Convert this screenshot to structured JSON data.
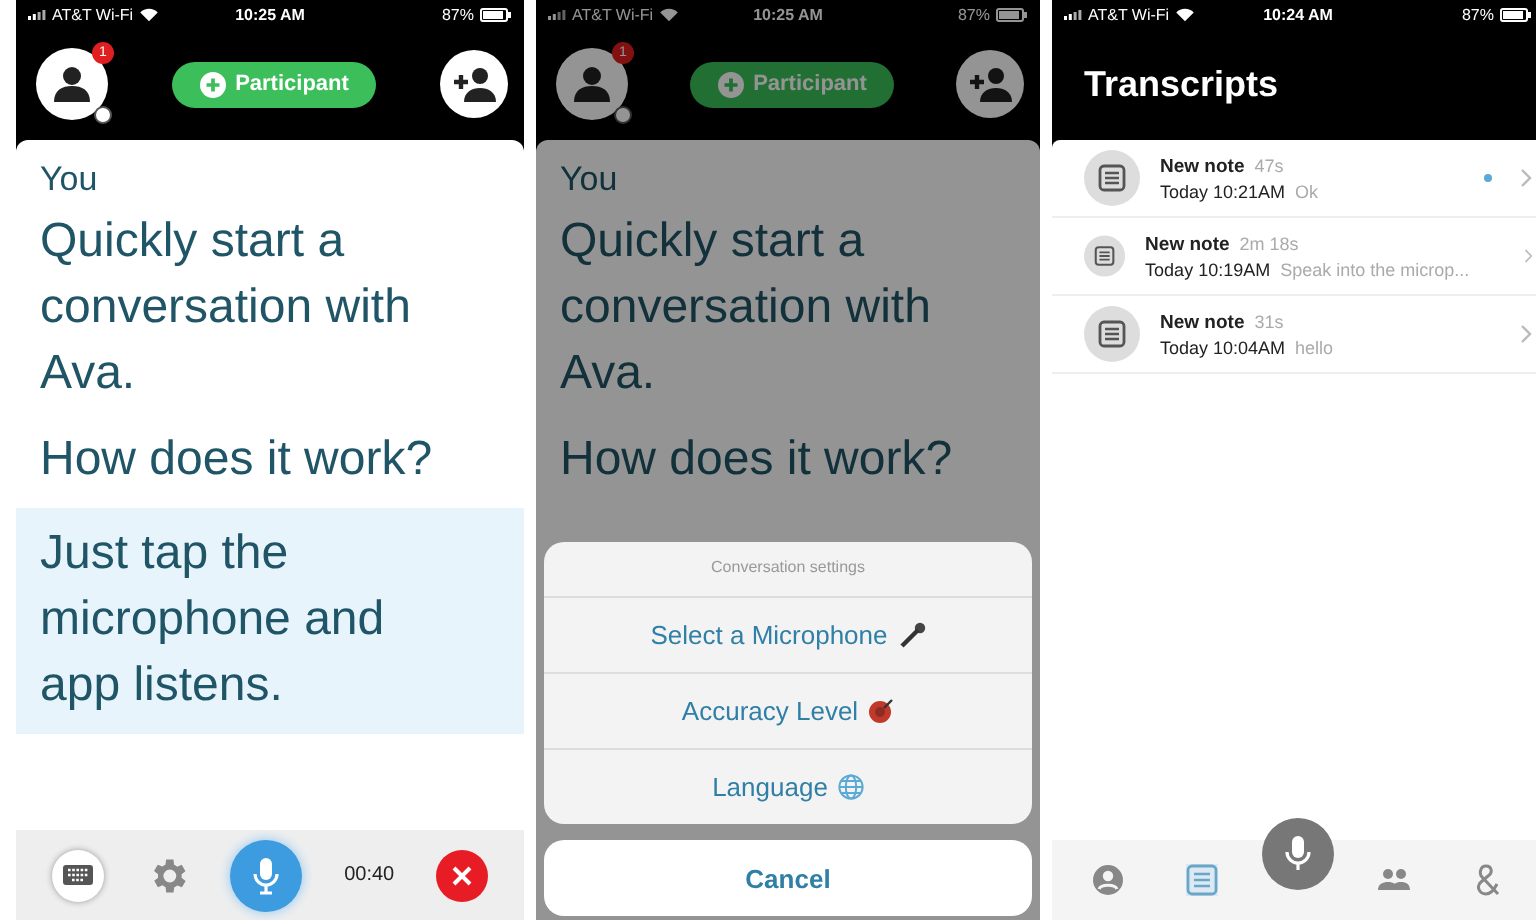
{
  "screens": [
    {
      "kind": "conversation",
      "dimmed": false,
      "status_bar": {
        "carrier": "AT&T Wi-Fi",
        "time": "10:25 AM",
        "battery": "87%"
      },
      "header": {
        "badge": "1",
        "participant_button": "Participant"
      },
      "messages": [
        {
          "kind": "speaker",
          "text": "You",
          "highlighted": false
        },
        {
          "kind": "message",
          "text": "Quickly start a conversation with Ava.",
          "highlighted": false
        },
        {
          "kind": "message",
          "text": "How does it work?",
          "highlighted": false
        },
        {
          "kind": "message",
          "text": "Just tap the microphone and app listens.",
          "highlighted": true
        }
      ],
      "toolbar": {
        "timer": "00:40"
      }
    },
    {
      "kind": "conversation",
      "dimmed": true,
      "status_bar": {
        "carrier": "AT&T Wi-Fi",
        "time": "10:25 AM",
        "battery": "87%"
      },
      "header": {
        "badge": "1",
        "participant_button": "Participant"
      },
      "messages": [
        {
          "kind": "speaker",
          "text": "You",
          "highlighted": false
        },
        {
          "kind": "message",
          "text": "Quickly start a conversation with Ava.",
          "highlighted": false
        },
        {
          "kind": "message",
          "text": "How does it work?",
          "highlighted": false
        }
      ],
      "sheet": {
        "title": "Conversation settings",
        "options": [
          {
            "kind": "microphone",
            "label": "Select a Microphone"
          },
          {
            "kind": "accuracy",
            "label": "Accuracy Level"
          },
          {
            "kind": "language",
            "label": "Language"
          }
        ],
        "cancel": "Cancel"
      }
    },
    {
      "kind": "transcripts",
      "status_bar": {
        "carrier": "AT&T Wi-Fi",
        "time": "10:24 AM",
        "battery": "87%"
      },
      "title": "Transcripts",
      "notes": [
        {
          "title": "New note",
          "duration": "47s",
          "date": "Today 10:21AM",
          "preview": "Ok",
          "unread": true
        },
        {
          "title": "New note",
          "duration": "2m 18s",
          "date": "Today 10:19AM",
          "preview": "Speak into the microp...",
          "unread": false
        },
        {
          "title": "New note",
          "duration": "31s",
          "date": "Today 10:04AM",
          "preview": "hello",
          "unread": false
        }
      ],
      "tab_bar": [
        {
          "kind": "profile",
          "selected": false
        },
        {
          "kind": "transcripts",
          "selected": true
        },
        {
          "kind": "captions",
          "selected": false
        },
        {
          "kind": "contacts",
          "selected": false
        },
        {
          "kind": "discover",
          "selected": false
        }
      ]
    }
  ]
}
